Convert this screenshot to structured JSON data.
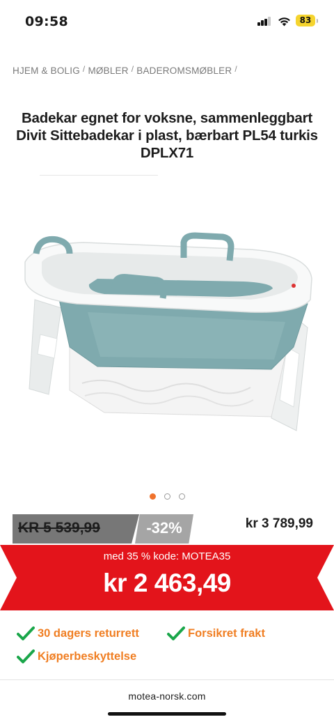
{
  "status_bar": {
    "time": "09:58",
    "battery": "83",
    "battery_color": "#f5d42f"
  },
  "breadcrumb": [
    {
      "label": "HJEM & BOLIG"
    },
    {
      "label": "MØBLER"
    },
    {
      "label": "BADEROMSMØBLER"
    }
  ],
  "breadcrumb_separator": "/",
  "product": {
    "title": "Badekar egnet for voksne, sammenleggbart Divit Sittebadekar i plast, bærbart PL54 turkis DPLX71",
    "image_icon": "folding-bathtub-image",
    "carousel": {
      "count": 3,
      "active": 1
    }
  },
  "pricing": {
    "old_price": "KR 5 539,99",
    "discount": "-32%",
    "current_price": "kr 3 789,99",
    "promo_code_text": "med 35 % kode: MOTEA35",
    "promo_price": "kr 2 463,49",
    "promo_color": "#e3141b"
  },
  "features": [
    {
      "label": "30 dagers returrett",
      "icon": "checkmark-icon"
    },
    {
      "label": "Forsikret frakt",
      "icon": "checkmark-icon"
    },
    {
      "label": "Kjøperbeskyttelse",
      "icon": "checkmark-icon"
    }
  ],
  "feature_colors": {
    "check": "#1aa64a",
    "text": "#f07e22"
  },
  "browser": {
    "url": "motea-norsk.com"
  }
}
